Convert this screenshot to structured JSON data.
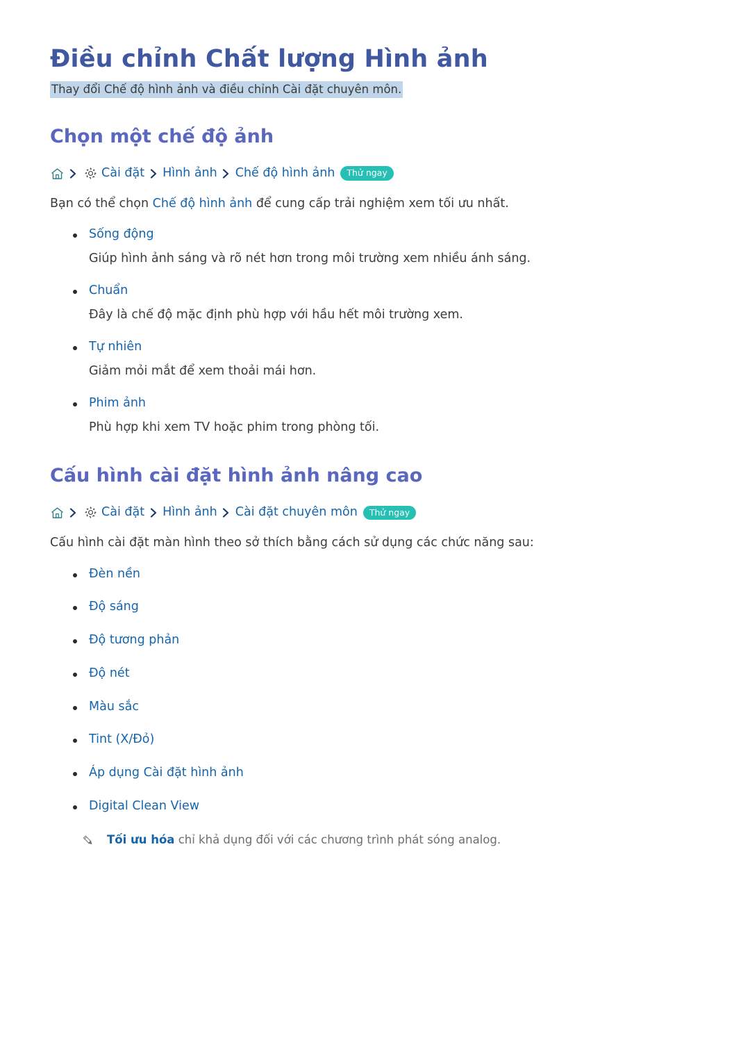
{
  "document": {
    "title": "Điều chỉnh Chất lượng Hình ảnh",
    "subtitle": "Thay đổi Chế độ hình ảnh và điều chỉnh Cài đặt chuyên môn."
  },
  "colors": {
    "title": "#40589f",
    "section_heading": "#5a67bf",
    "link": "#1565ad",
    "badge_background": "#25bfb4",
    "subtitle_highlight": "#bfd6ea",
    "body_text": "#3c3c3c",
    "note_text": "#6e6e6e",
    "home_icon": "#2f7f8f",
    "gear_icon": "#4a4a4a",
    "chevron": "#1f3864"
  },
  "sections": [
    {
      "heading": "Chọn một chế độ ảnh",
      "breadcrumb": {
        "home_icon": "home-icon",
        "gear_icon": "gear-icon",
        "separator": "chevron-right-icon",
        "items": [
          "Cài đặt",
          "Hình ảnh",
          "Chế độ hình ảnh"
        ],
        "badge": "Thử ngay"
      },
      "intro": {
        "before": "Bạn có thể chọn ",
        "emphasis": "Chế độ hình ảnh",
        "after": " để cung cấp trải nghiệm xem tối ưu nhất."
      },
      "definitions": [
        {
          "term": "Sống động",
          "description": "Giúp hình ảnh sáng và rõ nét hơn trong môi trường xem nhiều ánh sáng."
        },
        {
          "term": "Chuẩn",
          "description": "Đây là chế độ mặc định phù hợp với hầu hết môi trường xem."
        },
        {
          "term": "Tự nhiên",
          "description": "Giảm mỏi mắt để xem thoải mái hơn."
        },
        {
          "term": "Phim ảnh",
          "description": "Phù hợp khi xem TV hoặc phim trong phòng tối."
        }
      ]
    },
    {
      "heading": "Cấu hình cài đặt hình ảnh nâng cao",
      "breadcrumb": {
        "home_icon": "home-icon",
        "gear_icon": "gear-icon",
        "separator": "chevron-right-icon",
        "items": [
          "Cài đặt",
          "Hình ảnh",
          "Cài đặt chuyên môn"
        ],
        "badge": "Thử ngay"
      },
      "intro": {
        "before": "Cấu hình cài đặt màn hình theo sở thích bằng cách sử dụng các chức năng sau:",
        "emphasis": "",
        "after": ""
      },
      "links": [
        "Đèn nền",
        "Độ sáng",
        "Độ tương phản",
        "Độ nét",
        "Màu sắc",
        "Tint (X/Đỏ)",
        "Áp dụng Cài đặt hình ảnh",
        "Digital Clean View"
      ],
      "note": {
        "icon": "pencil-icon",
        "emphasis": "Tối ưu hóa",
        "text": " chỉ khả dụng đối với các chương trình phát sóng analog."
      }
    }
  ]
}
